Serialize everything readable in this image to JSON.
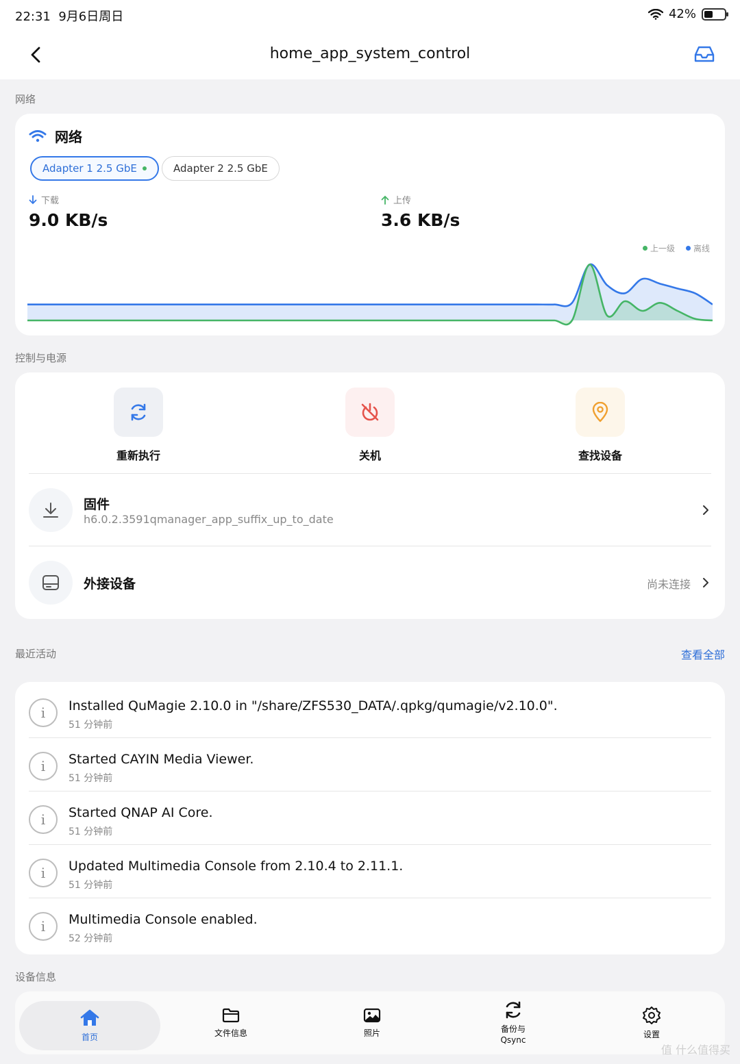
{
  "status_bar": {
    "time": "22:31",
    "date": "9月6日周日",
    "battery": "42%",
    "battery_level": 0.42
  },
  "nav": {
    "title": "home_app_system_control"
  },
  "network": {
    "section_label": "网络",
    "title": "网络",
    "adapters": [
      {
        "label": "Adapter 1 2.5 GbE"
      },
      {
        "label": "Adapter 2 2.5 GbE"
      }
    ],
    "download_label": "下载",
    "download_value": "9.0 KB/s",
    "upload_label": "上传",
    "upload_value": "3.6 KB/s",
    "legend": [
      {
        "name": "上一级",
        "color": "#45b566"
      },
      {
        "name": "离线",
        "color": "#3478e8"
      }
    ]
  },
  "chart_data": {
    "type": "area",
    "x": [
      0,
      1,
      2,
      3,
      4,
      5,
      6,
      7,
      8,
      9,
      10,
      11,
      12,
      13,
      14,
      15,
      16,
      17,
      18,
      19,
      20,
      21,
      22,
      23,
      24,
      25,
      26,
      27,
      28,
      29,
      30,
      31,
      32,
      33,
      34,
      35,
      36,
      37,
      38,
      39
    ],
    "series": [
      {
        "name": "离线",
        "color": "#3478e8",
        "values": [
          1,
          1,
          1,
          1,
          1,
          1,
          1,
          1,
          1,
          1,
          1,
          1,
          1,
          1,
          1,
          1,
          1,
          1,
          1,
          1,
          1,
          1,
          1,
          1,
          1,
          1,
          1,
          1,
          1,
          1,
          1,
          1.1,
          3.5,
          2.2,
          1.7,
          2.6,
          2.3,
          2.0,
          1.7,
          1.0
        ]
      },
      {
        "name": "上一级",
        "color": "#45b566",
        "values": [
          0,
          0,
          0,
          0,
          0,
          0,
          0,
          0,
          0,
          0,
          0,
          0,
          0,
          0,
          0,
          0,
          0,
          0,
          0,
          0,
          0,
          0,
          0,
          0,
          0,
          0,
          0,
          0,
          0,
          0,
          0,
          0,
          3.5,
          0.3,
          1.2,
          0.6,
          1.1,
          0.6,
          0.1,
          0
        ]
      }
    ]
  },
  "control": {
    "section_label": "控制与电源",
    "restart_label": "重新执行",
    "shutdown_label": "关机",
    "locate_label": "查找设备",
    "firmware_title": "固件",
    "firmware_sub": "h6.0.2.3591qmanager_app_suffix_up_to_date",
    "external_title": "外接设备",
    "external_status": "尚未连接"
  },
  "activity": {
    "section_label": "最近活动",
    "view_all": "查看全部",
    "items": [
      {
        "text": "Installed QuMagie 2.10.0 in \"/share/ZFS530_DATA/.qpkg/qumagie/v2.10.0\".",
        "time": "51 分钟前"
      },
      {
        "text": "Started CAYIN Media Viewer.",
        "time": "51 分钟前"
      },
      {
        "text": "Started QNAP AI Core.",
        "time": "51 分钟前"
      },
      {
        "text": "Updated Multimedia Console from 2.10.4 to 2.11.1.",
        "time": "51 分钟前"
      },
      {
        "text": "Multimedia Console enabled.",
        "time": "52 分钟前"
      }
    ]
  },
  "device_info": {
    "section_label": "设备信息"
  },
  "tabs": [
    {
      "label": "首页",
      "icon": "home-icon"
    },
    {
      "label": "文件信息",
      "icon": "folder-icon"
    },
    {
      "label": "照片",
      "icon": "photo-icon"
    },
    {
      "label": "备份与\nQsync",
      "icon": "sync-icon"
    },
    {
      "label": "设置",
      "icon": "gear-icon"
    }
  ],
  "watermark": "值 什么值得买",
  "colors": {
    "accent": "#2e6fd8",
    "green": "#45b566",
    "red": "#e5534b",
    "orange": "#f0a030"
  }
}
